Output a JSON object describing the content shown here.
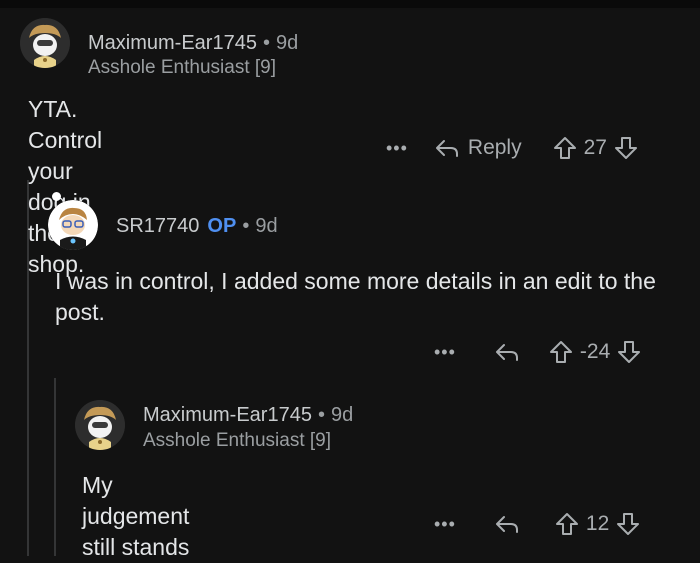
{
  "comments": [
    {
      "username": "Maximum-Ear1745",
      "separator": "•",
      "time": "9d",
      "flair": "Asshole Enthusiast [9]",
      "body": "YTA. Control your dog in the shop.",
      "more": "•••",
      "reply_label": "Reply",
      "votes": "27"
    },
    {
      "username": "SR17740",
      "op_badge": "OP",
      "separator": "•",
      "time": "9d",
      "body": "I was in control, I added some more details in an edit to the post.",
      "more": "•••",
      "votes": "-24"
    },
    {
      "username": "Maximum-Ear1745",
      "separator": "•",
      "time": "9d",
      "flair": "Asshole Enthusiast [9]",
      "body": "My judgement still stands",
      "more": "•••",
      "votes": "12"
    }
  ],
  "colors": {
    "background": "#121212",
    "op_accent": "#4f8ff0",
    "text": "#d7dadc",
    "meta": "#9a9ea1"
  }
}
